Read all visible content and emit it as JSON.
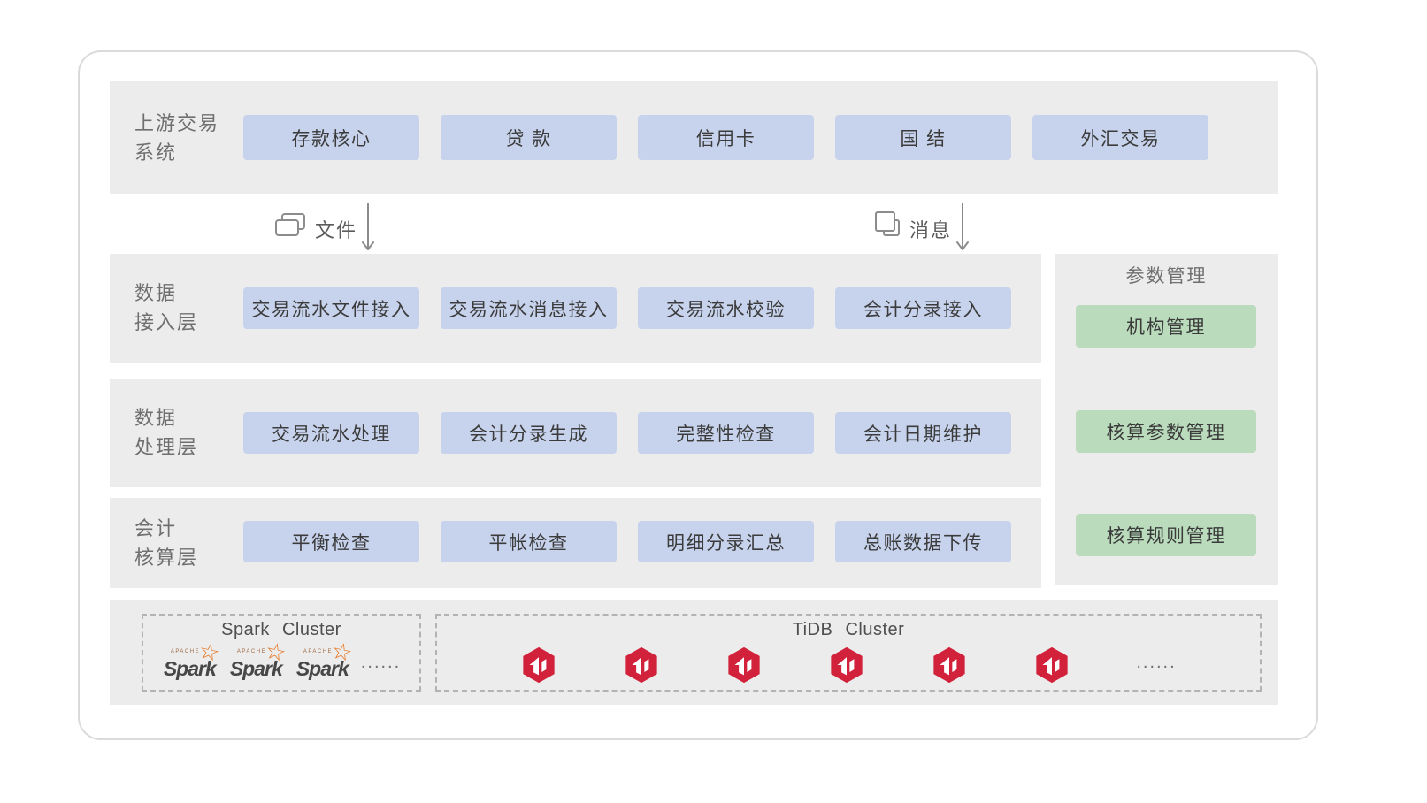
{
  "palette": {
    "band_bg": "#ECECEC",
    "blue_box": "#C7D3EC",
    "green_box": "#BADCBC",
    "card_border": "#DADADA",
    "layer_label_text": "#6F6F6F",
    "box_text": "#3B3B3B",
    "icon_gray": "#8C8C8C",
    "dashed_border": "#B3B3B3",
    "tidb_red": "#D2223B",
    "spark_orange": "#E8701A"
  },
  "icons": {
    "file_icon": "overlapping-pages-copy-glyph",
    "message_icon": "overlapping-squares-copy-glyph",
    "down_arrow": "↓",
    "spark_star_glyph": "☆",
    "tidb_logo": "red-hexagon-ti-mark"
  },
  "upstream": {
    "label_line1": "上游交易",
    "label_line2": "系统",
    "boxes": [
      "存款核心",
      "贷 款",
      "信用卡",
      "国 结",
      "外汇交易"
    ]
  },
  "connectors": {
    "file": {
      "label": "文件"
    },
    "message": {
      "label": "消息"
    }
  },
  "layers": [
    {
      "label_line1": "数据",
      "label_line2": "接入层",
      "boxes": [
        "交易流水文件接入",
        "交易流水消息接入",
        "交易流水校验",
        "会计分录接入"
      ]
    },
    {
      "label_line1": "数据",
      "label_line2": "处理层",
      "boxes": [
        "交易流水处理",
        "会计分录生成",
        "完整性检查",
        "会计日期维护"
      ]
    },
    {
      "label_line1": "会计",
      "label_line2": "核算层",
      "boxes": [
        "平衡检查",
        "平帐检查",
        "明细分录汇总",
        "总账数据下传"
      ]
    }
  ],
  "param_panel": {
    "title": "参数管理",
    "items": [
      "机构管理",
      "核算参数管理",
      "核算规则管理"
    ]
  },
  "infra": {
    "spark": {
      "title": "Spark Cluster",
      "logo_super": "APACHE",
      "logo_text": "Spark",
      "ellipsis": "......"
    },
    "tidb": {
      "title": "TiDB Cluster",
      "ellipsis": "......"
    }
  }
}
